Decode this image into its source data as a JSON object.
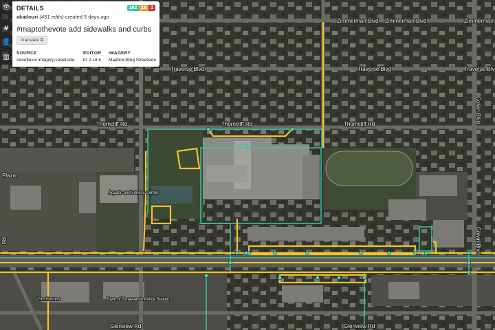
{
  "details": {
    "title": "DETAILS",
    "counts": {
      "created": "162",
      "modified": "18",
      "deleted": "1"
    },
    "user": "akadouri",
    "edits": "(451 edits)",
    "created": "created 5 days ago",
    "comment": "#maptothevote add sidewalks and curbs",
    "translate_label": "Translate",
    "source_label": "SOURCE",
    "source_value": "streetlevel imagery;streetside",
    "editor_label": "EDITOR",
    "editor_value": "iD 2.18.5",
    "imagery_label": "IMAGERY",
    "imagery_value": "Mapbox;Bing Streetside"
  },
  "sidebar_icons": [
    "eye-icon",
    "hash-icon",
    "user-icon",
    "building-icon"
  ],
  "colors": {
    "created": "#39c5a9",
    "modified": "#e8a23a",
    "deleted": "#d6303a",
    "way": "#f4c22b",
    "node": "#3fe0c2"
  },
  "map_labels": {
    "zimmerman_1": "Zimmerman Blvd",
    "zimmerman_2": "Zimmerman Blvd",
    "zimmerman_3": "Zimmerman Blvd",
    "traverse_1": "Traverse Blvd",
    "traverse_2": "Traverse Blvd",
    "traverse_3": "Traverse Blvd",
    "thorncliff_1": "Thorncliff Rd",
    "thorncliff_2": "Thorncliff Rd",
    "thorncliff_3": "Thorncliff Rd",
    "colvin_1": "Colvin Blvd",
    "colvin_2": "Colvin Blvd",
    "plaza": "Plaza",
    "aquatic": "Aquatic and Fitness Center",
    "tim_hortons": "Tim Hortons",
    "town_tonawanda": "Town of Tonawanda Police Station",
    "glenview": "Glenview Rd",
    "rd_left": "Rd"
  }
}
